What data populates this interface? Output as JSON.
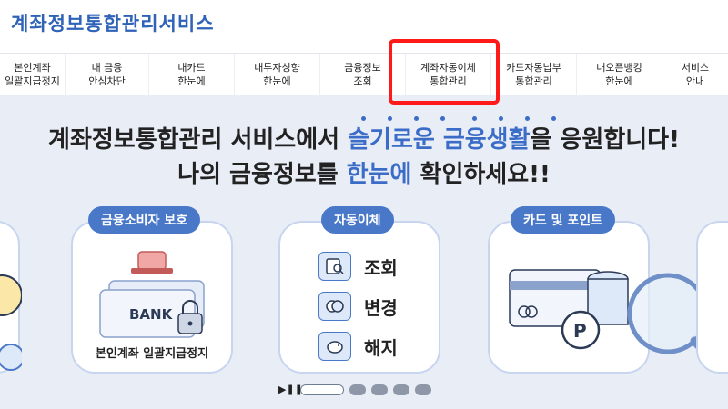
{
  "header": {
    "title": "계좌정보통합관리서비스"
  },
  "nav": {
    "items": [
      {
        "label": "본인계좌\n일괄지급정지"
      },
      {
        "label": "내 금융\n안심차단"
      },
      {
        "label": "내카드\n한눈에"
      },
      {
        "label": "내투자성향\n한눈에"
      },
      {
        "label": "금융정보\n조회"
      },
      {
        "label": "계좌자동이체\n통합관리"
      },
      {
        "label": "카드자동납부\n통합관리"
      },
      {
        "label": "내오픈뱅킹\n한눈에"
      },
      {
        "label": "서비스\n안내"
      }
    ]
  },
  "banner": {
    "headline_pre": "계좌정보통합관리 서비스에서 ",
    "headline_accent": "슬기로운 금융생활",
    "headline_post": "을 응원합니다!",
    "subline_pre": "나의 금융정보를 ",
    "subline_accent": "한눈에",
    "subline_post": " 확인하세요!!",
    "cards": [
      {
        "badge": "금융소비자 보호",
        "bank_text": "BANK",
        "footer": "본인계좌 일괄지급정지"
      },
      {
        "badge": "자동이체",
        "rows": [
          "조회",
          "변경",
          "해지"
        ]
      },
      {
        "badge": "카드 및 포인트",
        "point_symbol": "P"
      }
    ],
    "pagination": {
      "play_label": "▶❚❚"
    }
  },
  "colors": {
    "accent": "#3b6cc7",
    "badge": "#4a78c9",
    "banner_bg": "#e8edf6",
    "highlight": "#ff1a1a"
  }
}
